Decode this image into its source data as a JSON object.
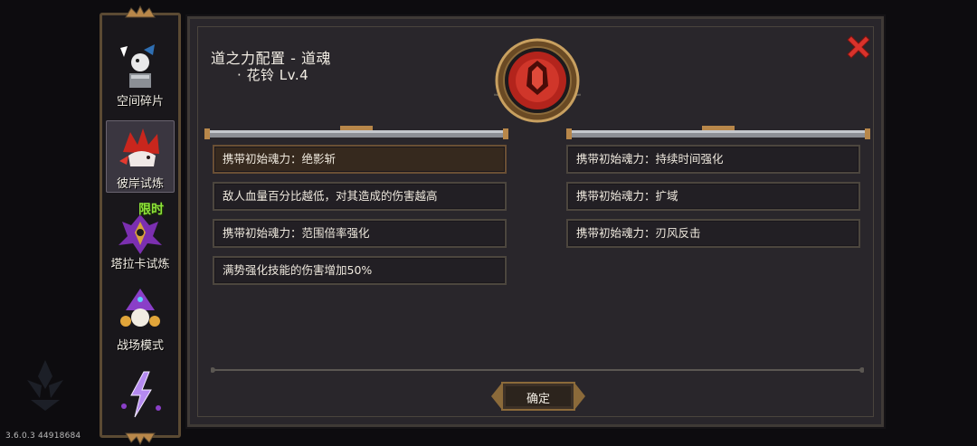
{
  "version": "3.6.0.3 44918684",
  "sidebar": {
    "items": [
      {
        "label": "空间碎片",
        "icon": "space-fragment-icon"
      },
      {
        "label": "彼岸试炼",
        "icon": "red-flower-beast-icon"
      },
      {
        "label": "塔拉卡试炼",
        "icon": "taraka-trial-icon",
        "badge": "限时"
      },
      {
        "label": "战场模式",
        "icon": "battlefield-wizard-icon"
      },
      {
        "label": "",
        "icon": "lightning-icon"
      }
    ]
  },
  "dialog": {
    "title": "道之力配置 - 道魂",
    "subtitle": "· 花铃 Lv.4",
    "emblem_icon": "red-soul-emblem-icon",
    "close_icon": "close-x-icon",
    "left_options": [
      "携带初始魂力：绝影斩",
      "敌人血量百分比越低，对其造成的伤害越高",
      "携带初始魂力：范围倍率强化",
      "满势强化技能的伤害增加50%"
    ],
    "right_options": [
      "携带初始魂力：持续时间强化",
      "携带初始魂力：扩域",
      "携带初始魂力：刃风反击"
    ],
    "selected_left_index": 0,
    "confirm_label": "确定"
  },
  "colors": {
    "panel_bg": "#29262b",
    "gold": "#b8874a",
    "close_red": "#d9322b",
    "emblem_red": "#c4281f",
    "badge_green": "#8de23a"
  }
}
